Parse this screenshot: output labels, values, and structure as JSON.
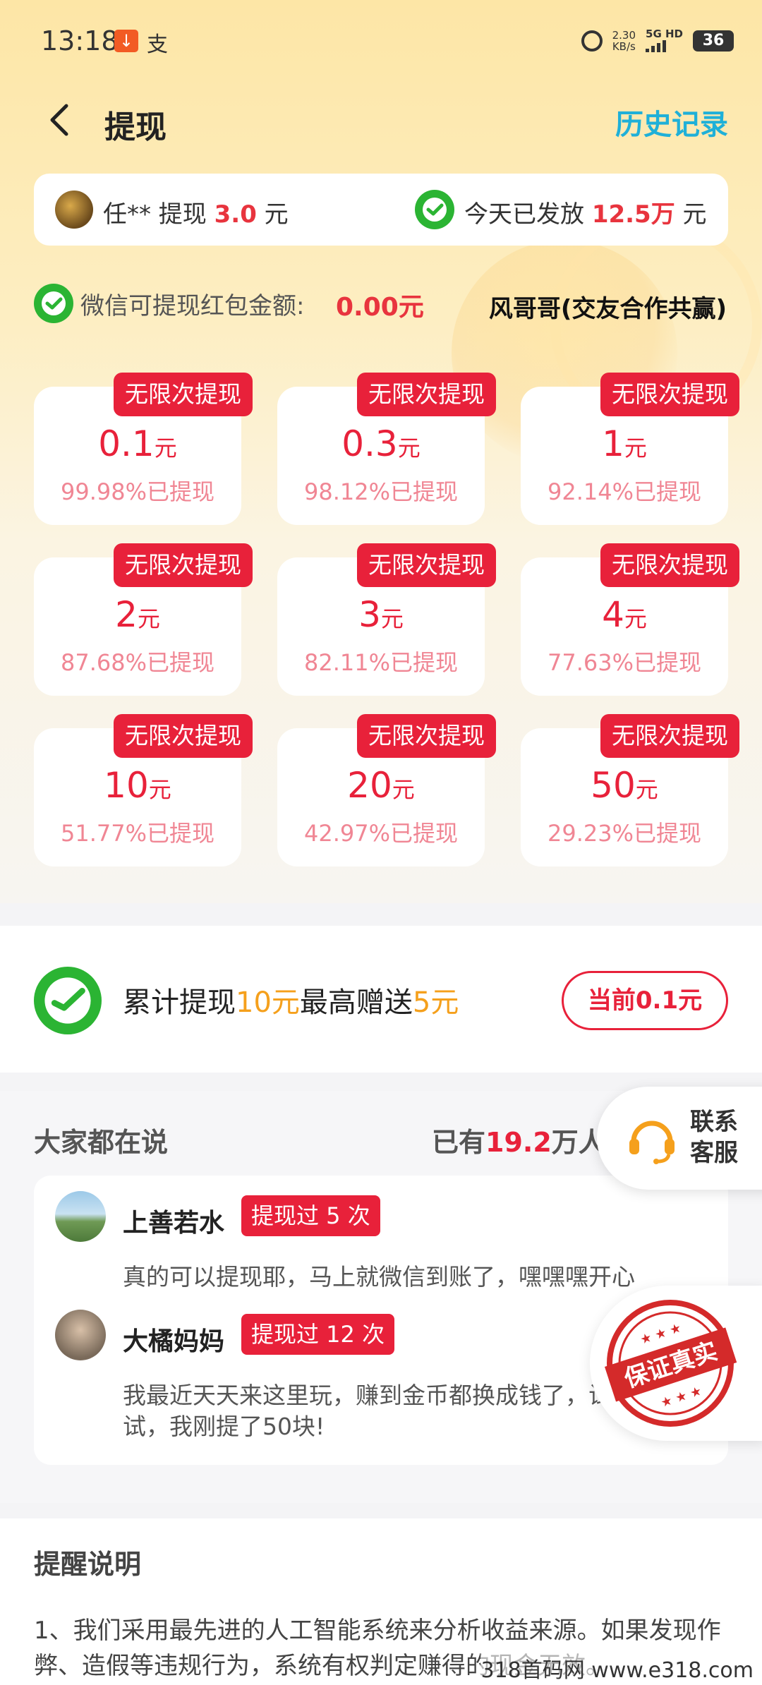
{
  "status_bar": {
    "time": "13:18",
    "speed_value": "2.30",
    "speed_unit": "KB/s",
    "network": "5G HD",
    "battery": "36",
    "alipay_glyph": "支"
  },
  "header": {
    "title": "提现",
    "history": "历史记录"
  },
  "ticker": {
    "user": "任**",
    "action": " 提现 ",
    "amount": "3.0",
    "unit": " 元",
    "today_label": "今天已发放 ",
    "today_amount": "12.5万",
    "today_unit": " 元"
  },
  "balance": {
    "label": "微信可提现红包金额:",
    "value": "0.00元",
    "user_name": "风哥哥(交友合作共赢)"
  },
  "options": [
    {
      "tag": "无限次提现",
      "amount": "0.1",
      "unit": "元",
      "rate": "99.98%已提现"
    },
    {
      "tag": "无限次提现",
      "amount": "0.3",
      "unit": "元",
      "rate": "98.12%已提现"
    },
    {
      "tag": "无限次提现",
      "amount": "1",
      "unit": "元",
      "rate": "92.14%已提现"
    },
    {
      "tag": "无限次提现",
      "amount": "2",
      "unit": "元",
      "rate": "87.68%已提现"
    },
    {
      "tag": "无限次提现",
      "amount": "3",
      "unit": "元",
      "rate": "82.11%已提现"
    },
    {
      "tag": "无限次提现",
      "amount": "4",
      "unit": "元",
      "rate": "77.63%已提现"
    },
    {
      "tag": "无限次提现",
      "amount": "10",
      "unit": "元",
      "rate": "51.77%已提现"
    },
    {
      "tag": "无限次提现",
      "amount": "20",
      "unit": "元",
      "rate": "42.97%已提现"
    },
    {
      "tag": "无限次提现",
      "amount": "50",
      "unit": "元",
      "rate": "29.23%已提现"
    }
  ],
  "bonus": {
    "pre": "累计提现",
    "amount1": "10元",
    "mid": "最高赠送",
    "amount2": "5元",
    "current": "当前0.1元"
  },
  "comments": {
    "title": "大家都在说",
    "count_pre": "已有",
    "count_value": "19.2",
    "count_post": "万人",
    "items": [
      {
        "name": "上善若水",
        "badge": "提现过 5 次",
        "text": "真的可以提现耶，马上就微信到账了，嘿嘿嘿开心"
      },
      {
        "name": "大橘妈妈",
        "badge": "提现过 12 次",
        "text": "我最近天天来这里玩，赚到金币都换成钱了，试试，我刚提了50块!"
      }
    ]
  },
  "service": {
    "label": "联系客服"
  },
  "stamp": {
    "text": "保证真实"
  },
  "notes": {
    "title": "提醒说明",
    "text": "1、我们采用最先进的人工智能系统来分析收益来源。如果发现作弊、造假等违规行为，系统有权判定赚得的现金无效。"
  },
  "watermark": "318首码网 www.e318.com",
  "colors": {
    "accent_red": "#e8213a",
    "wechat_green": "#2bb433",
    "link_blue": "#1fb0d8",
    "orange": "#f5a01c"
  }
}
